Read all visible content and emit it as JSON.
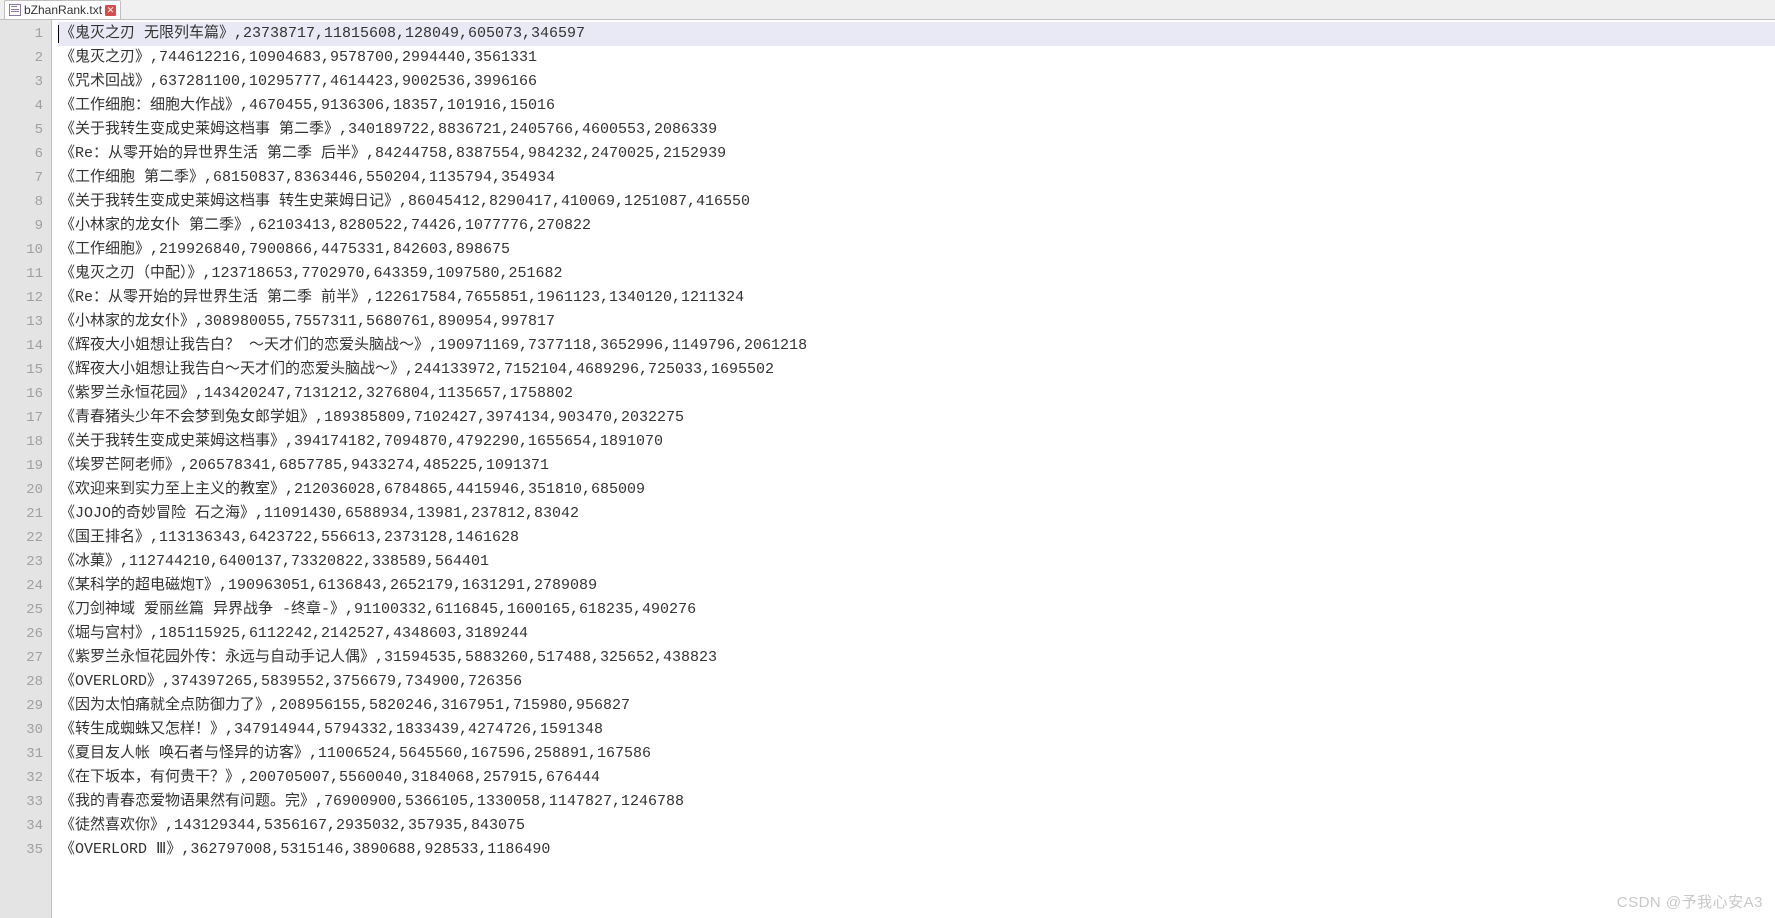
{
  "tab": {
    "filename": "bZhanRank.txt"
  },
  "lines": [
    "《鬼灭之刃 无限列车篇》,23738717,11815608,128049,605073,346597",
    "《鬼灭之刃》,744612216,10904683,9578700,2994440,3561331",
    "《咒术回战》,637281100,10295777,4614423,9002536,3996166",
    "《工作细胞：细胞大作战》,4670455,9136306,18357,101916,15016",
    "《关于我转生变成史莱姆这档事 第二季》,340189722,8836721,2405766,4600553,2086339",
    "《Re：从零开始的异世界生活 第二季 后半》,84244758,8387554,984232,2470025,2152939",
    "《工作细胞 第二季》,68150837,8363446,550204,1135794,354934",
    "《关于我转生变成史莱姆这档事 转生史莱姆日记》,86045412,8290417,410069,1251087,416550",
    "《小林家的龙女仆 第二季》,62103413,8280522,74426,1077776,270822",
    "《工作细胞》,219926840,7900866,4475331,842603,898675",
    "《鬼灭之刃（中配）》,123718653,7702970,643359,1097580,251682",
    "《Re：从零开始的异世界生活 第二季 前半》,122617584,7655851,1961123,1340120,1211324",
    "《小林家的龙女仆》,308980055,7557311,5680761,890954,997817",
    "《辉夜大小姐想让我告白？ ～天才们的恋爱头脑战～》,190971169,7377118,3652996,1149796,2061218",
    "《辉夜大小姐想让我告白～天才们的恋爱头脑战～》,244133972,7152104,4689296,725033,1695502",
    "《紫罗兰永恒花园》,143420247,7131212,3276804,1135657,1758802",
    "《青春猪头少年不会梦到兔女郎学姐》,189385809,7102427,3974134,903470,2032275",
    "《关于我转生变成史莱姆这档事》,394174182,7094870,4792290,1655654,1891070",
    "《埃罗芒阿老师》,206578341,6857785,9433274,485225,1091371",
    "《欢迎来到实力至上主义的教室》,212036028,6784865,4415946,351810,685009",
    "《JOJO的奇妙冒险 石之海》,11091430,6588934,13981,237812,83042",
    "《国王排名》,113136343,6423722,556613,2373128,1461628",
    "《冰菓》,112744210,6400137,73320822,338589,564401",
    "《某科学的超电磁炮T》,190963051,6136843,2652179,1631291,2789089",
    "《刀剑神域 爱丽丝篇 异界战争 -终章-》,91100332,6116845,1600165,618235,490276",
    "《堀与宫村》,185115925,6112242,2142527,4348603,3189244",
    "《紫罗兰永恒花园外传：永远与自动手记人偶》,31594535,5883260,517488,325652,438823",
    "《OVERLORD》,374397265,5839552,3756679,734900,726356",
    "《因为太怕痛就全点防御力了》,208956155,5820246,3167951,715980,956827",
    "《转生成蜘蛛又怎样！》,347914944,5794332,1833439,4274726,1591348",
    "《夏目友人帐 唤石者与怪异的访客》,11006524,5645560,167596,258891,167586",
    "《在下坂本，有何贵干？》,200705007,5560040,3184068,257915,676444",
    "《我的青春恋爱物语果然有问题。完》,76900900,5366105,1330058,1147827,1246788",
    "《徒然喜欢你》,143129344,5356167,2935032,357935,843075",
    "《OVERLORD Ⅲ》,362797008,5315146,3890688,928533,1186490"
  ],
  "watermark": "CSDN @予我心安A3"
}
